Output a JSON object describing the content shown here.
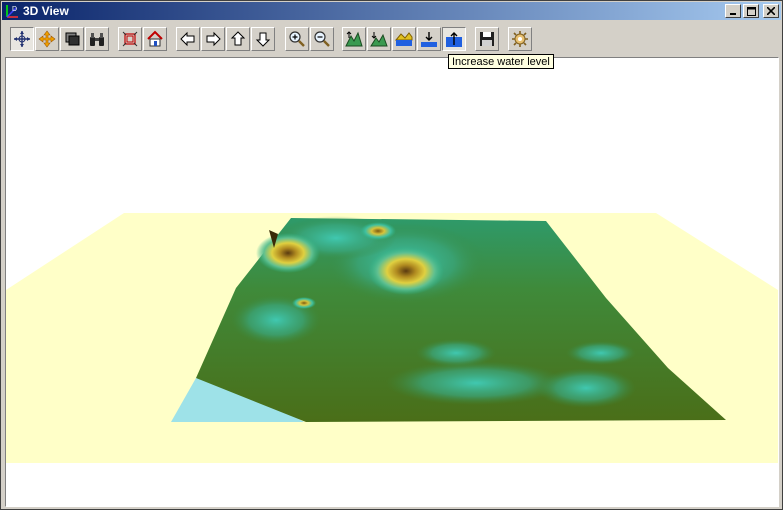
{
  "window": {
    "title": "3D View",
    "buttons": [
      {
        "name": "minimize",
        "glyph": "_"
      },
      {
        "name": "maximize",
        "glyph": "□"
      },
      {
        "name": "close",
        "glyph": "✕"
      }
    ]
  },
  "toolbar": {
    "items": [
      {
        "icon": "rotate-view-icon",
        "pressed": true
      },
      {
        "icon": "pan-view-icon",
        "pressed": false
      },
      {
        "icon": "layers-icon",
        "pressed": false
      },
      {
        "icon": "binoculars-icon",
        "pressed": false
      },
      {
        "icon": "fit-extent-icon",
        "pressed": false
      },
      {
        "icon": "home-icon",
        "pressed": false
      },
      {
        "icon": "arrow-left-icon",
        "pressed": false
      },
      {
        "icon": "arrow-right-icon",
        "pressed": false
      },
      {
        "icon": "arrow-up-icon",
        "pressed": false
      },
      {
        "icon": "arrow-down-icon",
        "pressed": false
      },
      {
        "icon": "zoom-in-icon",
        "pressed": false
      },
      {
        "icon": "zoom-out-icon",
        "pressed": false
      },
      {
        "icon": "increase-exaggeration-icon",
        "pressed": false
      },
      {
        "icon": "decrease-exaggeration-icon",
        "pressed": false
      },
      {
        "icon": "water-toggle-icon",
        "pressed": false
      },
      {
        "icon": "decrease-water-level-icon",
        "pressed": false
      },
      {
        "icon": "increase-water-level-icon",
        "pressed": false
      },
      {
        "icon": "save-icon",
        "pressed": false
      },
      {
        "icon": "settings-icon",
        "pressed": false
      }
    ]
  },
  "tooltip": {
    "text": "Increase water level"
  },
  "scene": {
    "background": "#ffffff",
    "base_plane_color": "#ffffc8",
    "water_color": "#9ee2e8",
    "terrain_low_color": "#4a7a1e",
    "terrain_mid_color": "#2fb58a",
    "terrain_high_color": "#d8c23a"
  }
}
